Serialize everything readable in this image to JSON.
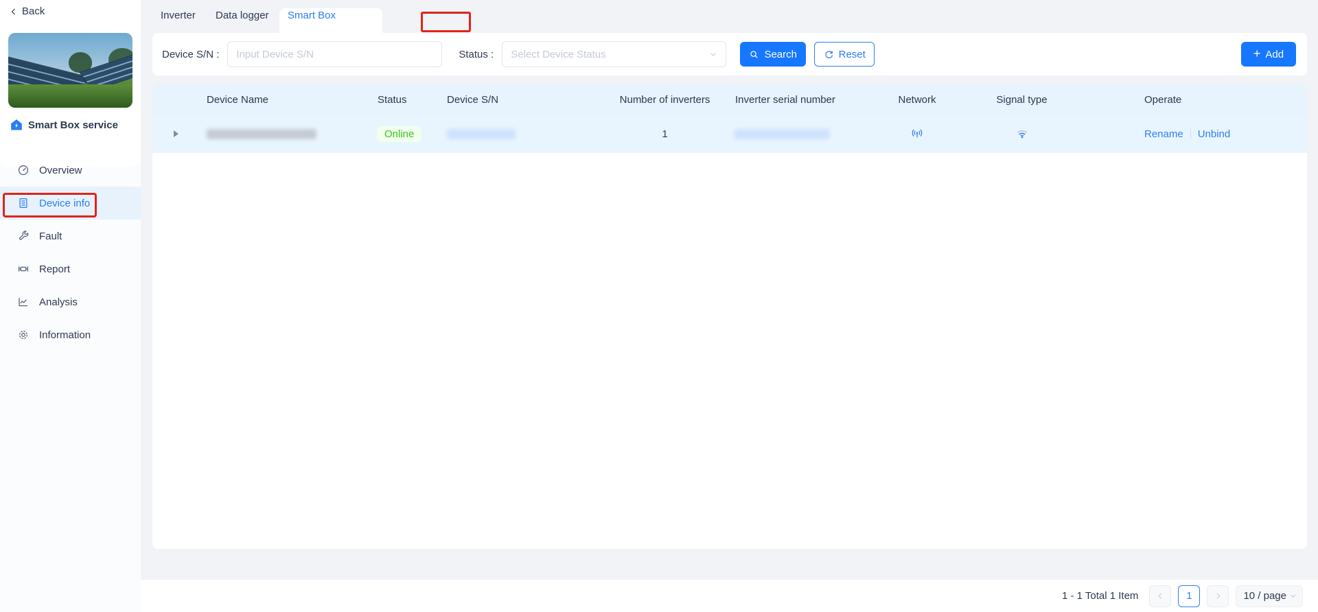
{
  "sidebar": {
    "back_label": "Back",
    "service_title": "Smart Box service",
    "items": [
      {
        "label": "Overview",
        "icon": "gauge-icon",
        "active": false
      },
      {
        "label": "Device info",
        "icon": "device-list-icon",
        "active": true
      },
      {
        "label": "Fault",
        "icon": "wrench-icon",
        "active": false
      },
      {
        "label": "Report",
        "icon": "report-icon",
        "active": false
      },
      {
        "label": "Analysis",
        "icon": "chart-icon",
        "active": false
      },
      {
        "label": "Information",
        "icon": "gear-icon",
        "active": false
      }
    ]
  },
  "tabs": [
    {
      "label": "Inverter",
      "active": false
    },
    {
      "label": "Data logger",
      "active": false
    },
    {
      "label": "Smart Box",
      "active": true
    }
  ],
  "filters": {
    "device_sn_label": "Device S/N :",
    "device_sn_placeholder": "Input Device S/N",
    "status_label": "Status :",
    "status_placeholder": "Select Device Status",
    "search_label": "Search",
    "reset_label": "Reset",
    "add_label": "Add",
    "plus_glyph": "+"
  },
  "table": {
    "columns": [
      "Device Name",
      "Status",
      "Device S/N",
      "Number of inverters",
      "Inverter serial number",
      "Network",
      "Signal type",
      "Operate"
    ],
    "row": {
      "device_name_redacted": true,
      "status": "Online",
      "device_sn_redacted": true,
      "inverter_count": "1",
      "inverter_serial_redacted": true,
      "network_icon": "antenna-icon",
      "signal_icon": "wifi-icon",
      "actions": [
        "Rename",
        "Unbind"
      ]
    }
  },
  "pagination": {
    "summary": "1 - 1 Total 1 Item",
    "current_page": "1",
    "page_size": "10 / page"
  },
  "colors": {
    "accent_blue": "#1677ff",
    "link_blue": "#2a7ef2",
    "online_green": "#35c71f",
    "online_bg": "#f1ffec",
    "table_header_bg": "#e7f3fd",
    "row_highlight_bg": "#e9f5fe",
    "annotation_red": "#e02317",
    "page_bg": "#f1f3f6"
  }
}
